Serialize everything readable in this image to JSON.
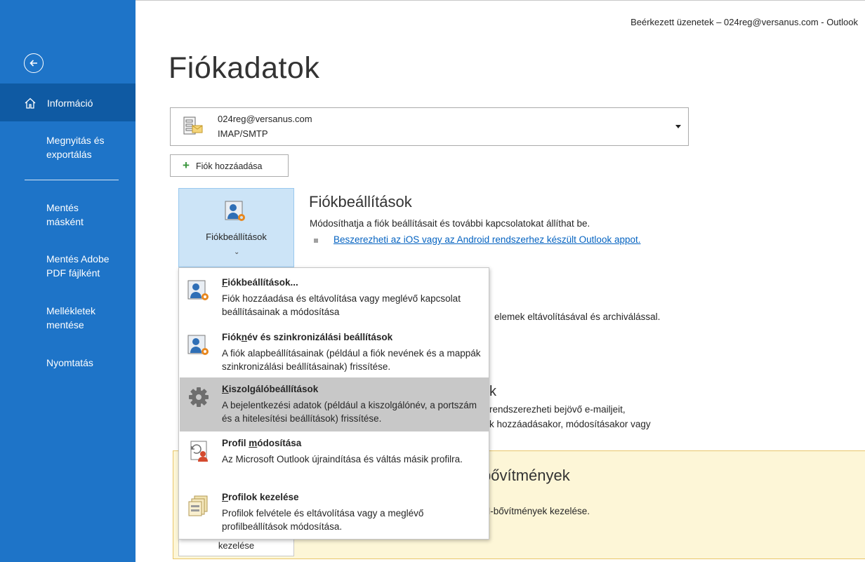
{
  "window": {
    "title": "Beérkezett üzenetek – 024reg@versanus.com  -  Outlook"
  },
  "sidebar": {
    "items": [
      {
        "label": "Információ"
      },
      {
        "label": "Megnyitás és\nexportálás"
      },
      {
        "label": "Mentés\nmásként"
      },
      {
        "label": "Mentés Adobe\nPDF fájlként"
      },
      {
        "label": "Mellékletek\nmentése"
      },
      {
        "label": "Nyomtatás"
      }
    ]
  },
  "main": {
    "title": "Fiókadatok",
    "account": {
      "email": "024reg@versanus.com",
      "type": "IMAP/SMTP"
    },
    "add_account_label": "Fiók hozzáadása",
    "settings_tile_label": "Fiókbeállítások",
    "settings_section": {
      "heading": "Fiókbeállítások",
      "description": "Módosíthatja a fiók beállításait és további kapcsolatokat állíthat be.",
      "link": "Beszerezheti az iOS vagy az Android rendszerhez készült Outlook appot."
    },
    "background": {
      "cleanup_text": "elemek eltávolításával és archiválással.",
      "rules_k": "k",
      "rules_line1": "rendszerezheti bejövő e-mailjeit,",
      "rules_line2": "k hozzáadásakor, módosításakor vagy",
      "addins_heading": "bővítmények",
      "addins_desc": "M-bővítmények kezelése.",
      "addins_button": "kezelése"
    }
  },
  "menu": {
    "items": [
      {
        "title_pre": "",
        "title_u": "F",
        "title_post": "iókbeállítások...",
        "desc": "Fiók hozzáadása és eltávolítása vagy meglévő kapcsolat beállításainak a módosítása",
        "icon": "account-settings-icon"
      },
      {
        "title_pre": "Fiók",
        "title_u": "n",
        "title_post": "év és szinkronizálási beállítások",
        "desc": "A fiók alapbeállításainak (például a fiók nevének és a mappák szinkronizálási beállításainak) frissítése.",
        "icon": "account-name-sync-icon"
      },
      {
        "title_pre": "",
        "title_u": "K",
        "title_post": "iszolgálóbeállítások",
        "desc": "A bejelentkezési adatok (például a kiszolgálónév, a portszám és a hitelesítési beállítások) frissítése.",
        "icon": "gear-icon"
      },
      {
        "title_pre": "Profil ",
        "title_u": "m",
        "title_post": "ódosítása",
        "desc": "Az Microsoft Outlook újraindítása és váltás másik profilra.",
        "icon": "change-profile-icon"
      },
      {
        "title_pre": "",
        "title_u": "P",
        "title_post": "rofilok kezelése",
        "desc": "Profilok felvétele és eltávolítása vagy a meglévő profilbeállítások módosítása.",
        "icon": "manage-profiles-icon"
      }
    ]
  },
  "colors": {
    "sidebar_bg": "#1e74c8",
    "sidebar_selected": "#0f5aa3",
    "tile_bg": "#cce4f7",
    "menu_hover": "#c8c8c8",
    "addins_bg": "#fdf6d7",
    "link": "#0563c1"
  }
}
